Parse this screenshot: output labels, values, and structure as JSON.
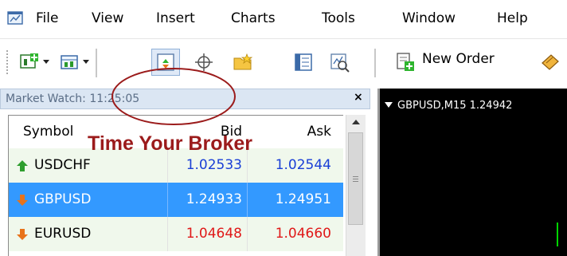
{
  "menu": {
    "items": [
      "File",
      "View",
      "Insert",
      "Charts",
      "Tools",
      "Window",
      "Help"
    ]
  },
  "toolbar": {
    "new_order_label": "New Order"
  },
  "market_watch": {
    "title": "Market Watch: 11:25:05",
    "close_glyph": "×",
    "columns": {
      "symbol": "Symbol",
      "bid": "Bid",
      "ask": "Ask"
    },
    "rows": [
      {
        "symbol": "USDCHF",
        "bid": "1.02533",
        "ask": "1.02544",
        "direction": "up",
        "price_color": "#1a3fd6",
        "selected": false
      },
      {
        "symbol": "GBPUSD",
        "bid": "1.24933",
        "ask": "1.24951",
        "direction": "down",
        "price_color": "#ffffff",
        "selected": true
      },
      {
        "symbol": "EURUSD",
        "bid": "1.04648",
        "ask": "1.04660",
        "direction": "down",
        "price_color": "#e01818",
        "selected": false
      }
    ]
  },
  "chart": {
    "title": "GBPUSD,M15  1.24942"
  },
  "watermark": "Time Your Broker",
  "colors": {
    "up_arrow": "#2e9e2e",
    "down_arrow": "#e8731a",
    "selection": "#3399ff",
    "annotation": "#9b1b1b"
  }
}
